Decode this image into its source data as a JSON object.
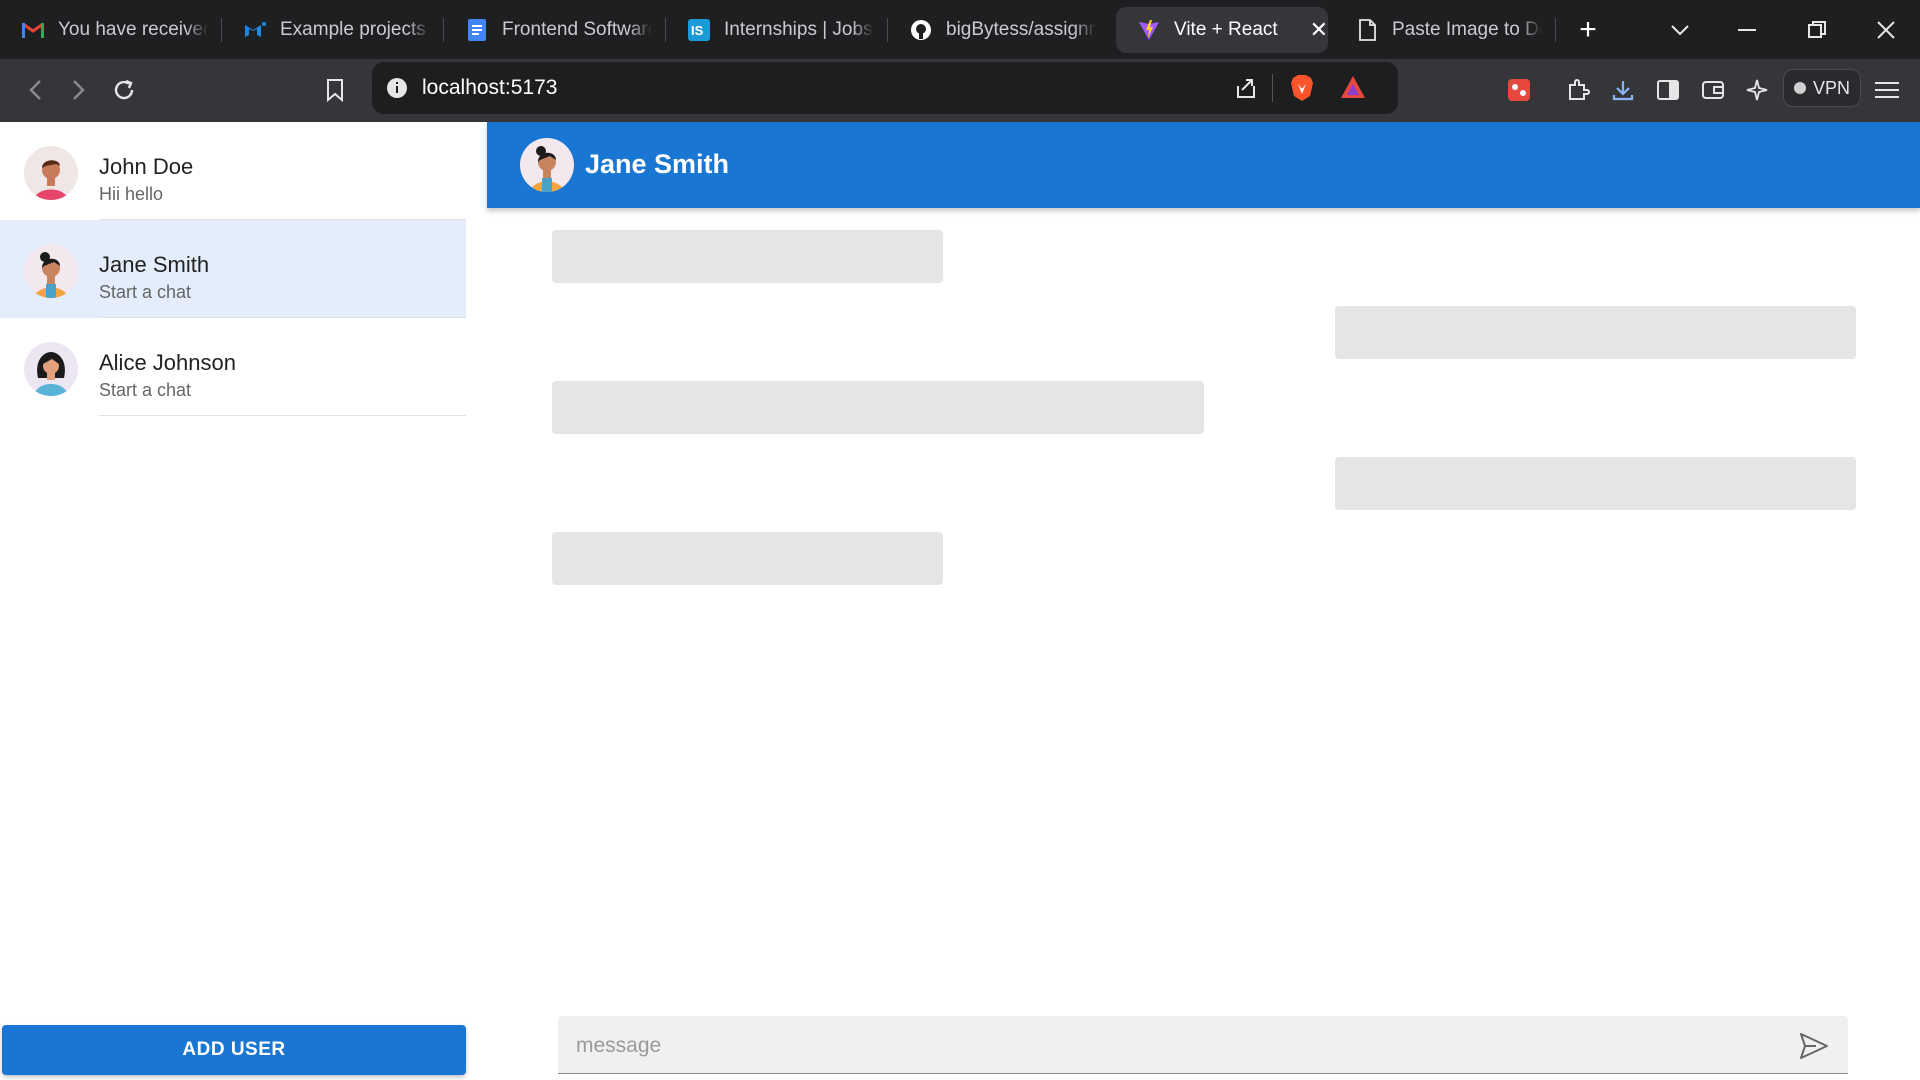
{
  "browser": {
    "tabs": [
      {
        "title": "You have received",
        "icon": "gmail-icon"
      },
      {
        "title": "Example projects -",
        "icon": "mui-icon"
      },
      {
        "title": "Frontend Software",
        "icon": "docs-icon"
      },
      {
        "title": "Internships | Jobs |",
        "icon": "internshala-icon"
      },
      {
        "title": "bigBytess/assignm",
        "icon": "github-icon"
      },
      {
        "title": "Vite + React",
        "icon": "vite-icon",
        "active": true
      },
      {
        "title": "Paste Image to Do",
        "icon": "page-icon"
      }
    ],
    "url": "localhost:5173",
    "vpn_label": "VPN"
  },
  "sidebar": {
    "contacts": [
      {
        "name": "John Doe",
        "preview": "Hii hello"
      },
      {
        "name": "Jane Smith",
        "preview": "Start a chat",
        "selected": true
      },
      {
        "name": "Alice Johnson",
        "preview": "Start a chat"
      }
    ],
    "add_user_label": "ADD USER"
  },
  "chat": {
    "title": "Jane Smith",
    "composer_placeholder": "message"
  },
  "colors": {
    "accent": "#1976d2",
    "selected_row": "#e3edfb",
    "skeleton": "#e5e5e5"
  }
}
